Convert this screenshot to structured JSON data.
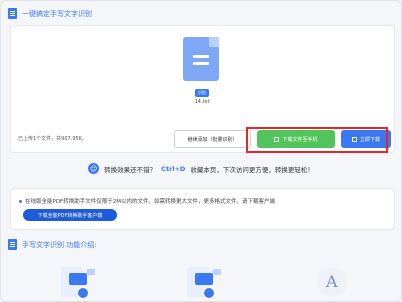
{
  "header": {
    "title": "一键搞定手写文字识别"
  },
  "file": {
    "tag": "识别",
    "name": "14.txt"
  },
  "toolbar": {
    "summary": "已上传1个文件，共907.95K。",
    "continue_label": "继续添加（批量识别）",
    "download_phone_label": "下载文件至手机",
    "download_now_label": "立即下载"
  },
  "promo": {
    "prefix": "转换效果还不错？",
    "shortcut": "Ctrl+D",
    "suffix": "收藏本页，下次访问更方便，转换更轻松！"
  },
  "notice": {
    "text": "在线版全能PDF转换助手文件仅限于2M以内的文件，如需转换更大文件，更多格式文件，请下载客户端",
    "button": "下载全能PDF转换助手客户端"
  },
  "section2": {
    "title": "手写文字识别 功能介绍:"
  },
  "colors": {
    "accent": "#3a79f1",
    "green": "#52c45c",
    "highlight": "#e02a2a"
  }
}
